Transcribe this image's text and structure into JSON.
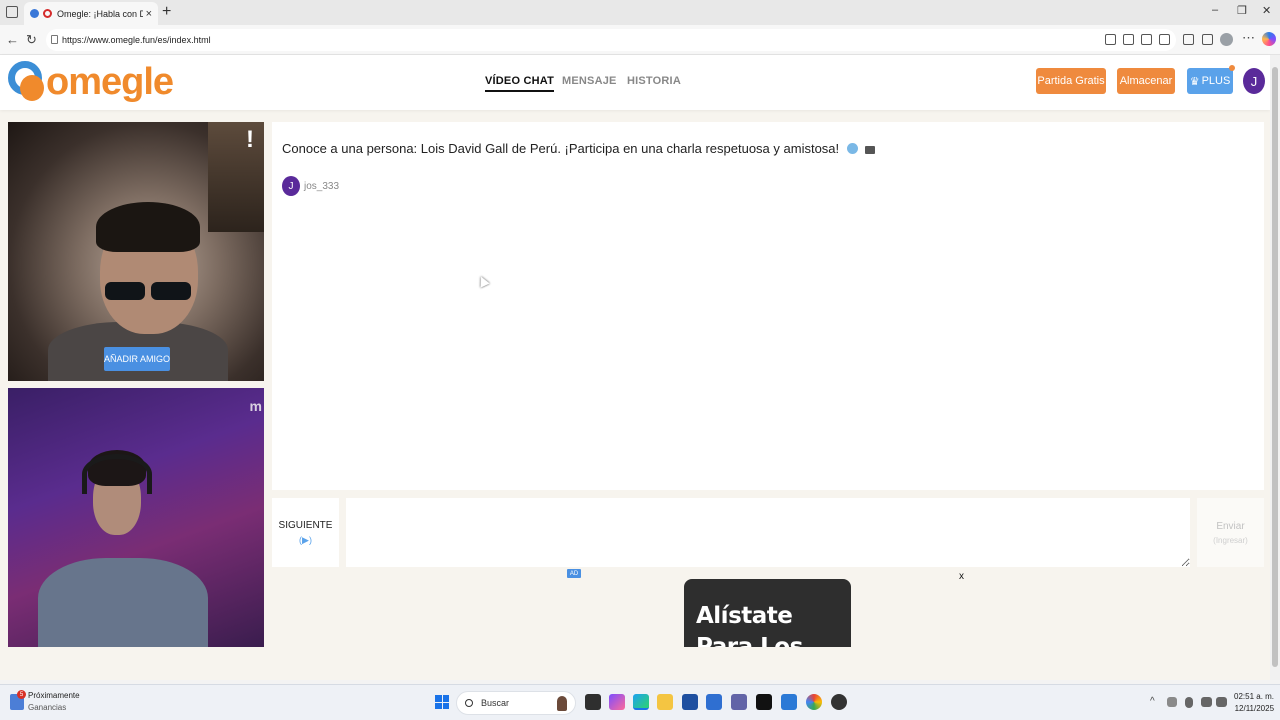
{
  "browser": {
    "tab_title": "Omegle: ¡Habla con Descon",
    "url": "https://www.omegle.fun/es/index.html",
    "tab_close": "×",
    "new_tab": "+",
    "back": "←",
    "reload": "↻",
    "window_min": "–",
    "window_max": "❐",
    "window_close": "✕",
    "more": "⋯"
  },
  "site": {
    "logo_text": "omegle",
    "nav": [
      {
        "label": "VÍDEO CHAT",
        "active": true
      },
      {
        "label": "MENSAJE",
        "active": false
      },
      {
        "label": "HISTORIA",
        "active": false
      }
    ],
    "buttons": {
      "free_match": "Partida Gratis",
      "store": "Almacenar",
      "plus": "PLUS",
      "plus_icon": "♛",
      "user_initial": "J"
    }
  },
  "video": {
    "report_mark": "!",
    "add_friend": "AÑADIR AMIGO",
    "watermark": "m"
  },
  "chat": {
    "intro": "Conoce a una persona: Lois David Gall de Perú. ¡Participa en una charla respetuosa y amistosa!",
    "user_initial": "J",
    "username": "jos_333"
  },
  "controls": {
    "next_label": "SIGUIENTE",
    "next_hint": "(▶)",
    "send_label": "Enviar",
    "send_hint": "(Ingresar)"
  },
  "ad": {
    "tag": "AD",
    "close": "x",
    "headline": "Alístate Para Los Premos"
  },
  "taskbar": {
    "widget_badge": "5",
    "widget_title": "Próximamente",
    "widget_sub": "Ganancias",
    "search_placeholder": "Buscar",
    "time": "02:51 a. m.",
    "date": "12/11/2025",
    "tray_chevron": "^"
  },
  "colors": {
    "accent_orange": "#ef8a3e",
    "accent_blue": "#5aa2ea",
    "avatar_purple": "#5a2a9a"
  }
}
